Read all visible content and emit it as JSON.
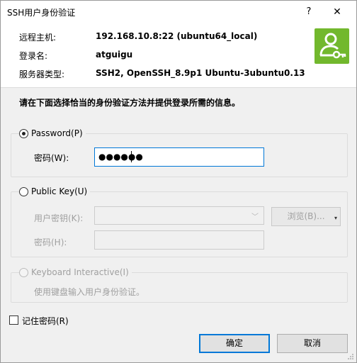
{
  "window": {
    "title": "SSH用户身份验证",
    "help": "?",
    "close": "✕"
  },
  "info": {
    "host_label": "远程主机:",
    "host_value": "192.168.10.8:22 (ubuntu64_local)",
    "login_label": "登录名:",
    "login_value": "atguigu",
    "server_label": "服务器类型:",
    "server_value": "SSH2, OpenSSH_8.9p1 Ubuntu-3ubuntu0.13",
    "icon": "user-key-icon",
    "icon_color": "#72b82d"
  },
  "instruction": "请在下面选择恰当的身份验证方法并提供登录所需的信息。",
  "password_group": {
    "label": "Password(P)",
    "selected": true,
    "field_label": "密码(W):",
    "masked_value": "●●●●●●"
  },
  "publickey_group": {
    "label": "Public Key(U)",
    "selected": false,
    "key_label": "用户密钥(K):",
    "browse_label": "浏览(B)...",
    "passphrase_label": "密码(H):"
  },
  "keyboard_group": {
    "label": "Keyboard Interactive(I)",
    "selected": false,
    "description": "使用键盘输入用户身份验证。"
  },
  "remember": {
    "label": "记住密码(R)",
    "checked": false
  },
  "buttons": {
    "ok": "确定",
    "cancel": "取消"
  },
  "colors": {
    "accent": "#0078d7",
    "icon_bg": "#72b82d"
  }
}
